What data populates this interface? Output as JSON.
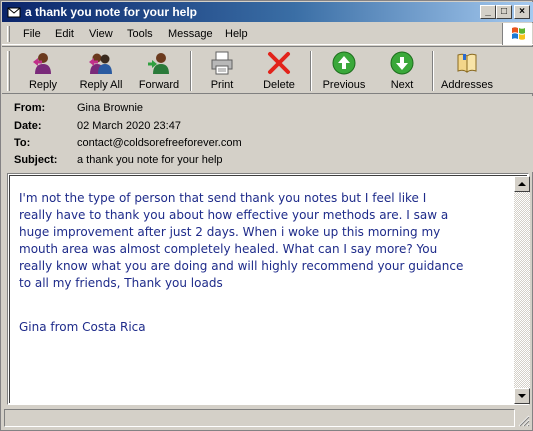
{
  "window": {
    "title": "a thank you note for your help",
    "controls": {
      "minimize": "_",
      "maximize": "□",
      "close": "×"
    }
  },
  "menu": {
    "items": [
      {
        "label": "File"
      },
      {
        "label": "Edit"
      },
      {
        "label": "View"
      },
      {
        "label": "Tools"
      },
      {
        "label": "Message"
      },
      {
        "label": "Help"
      }
    ]
  },
  "toolbar": {
    "buttons": [
      {
        "label": "Reply",
        "icon": "reply-icon"
      },
      {
        "label": "Reply All",
        "icon": "reply-all-icon"
      },
      {
        "label": "Forward",
        "icon": "forward-icon"
      },
      {
        "label": "Print",
        "icon": "printer-icon"
      },
      {
        "label": "Delete",
        "icon": "delete-x-icon"
      },
      {
        "label": "Previous",
        "icon": "up-arrow-icon"
      },
      {
        "label": "Next",
        "icon": "down-arrow-icon"
      },
      {
        "label": "Addresses",
        "icon": "address-book-icon"
      }
    ]
  },
  "headers": {
    "from_label": "From:",
    "from": "Gina Brownie",
    "date_label": "Date:",
    "date": "02 March 2020 23:47",
    "to_label": "To:",
    "to": "contact@coldsorefreeforever.com",
    "subject_label": "Subject:",
    "subject": "a thank you note for your help"
  },
  "message": {
    "lines": [
      "I'm not the type of person that send thank you notes but I feel like I",
      "really have to thank you about how effective your methods are. I saw a",
      "huge improvement after just 2 days. When i woke up this morning my",
      "mouth area was almost completely healed. What can I say more? You",
      "really know what you are doing and will highly recommend your guidance",
      "to all my friends, Thank you loads"
    ],
    "signature": "Gina from Costa Rica"
  },
  "colors": {
    "title_gradient_start": "#0a246a",
    "title_gradient_end": "#a6caf0",
    "body_text": "#1e2b8a",
    "chrome": "#d4d0c8"
  }
}
